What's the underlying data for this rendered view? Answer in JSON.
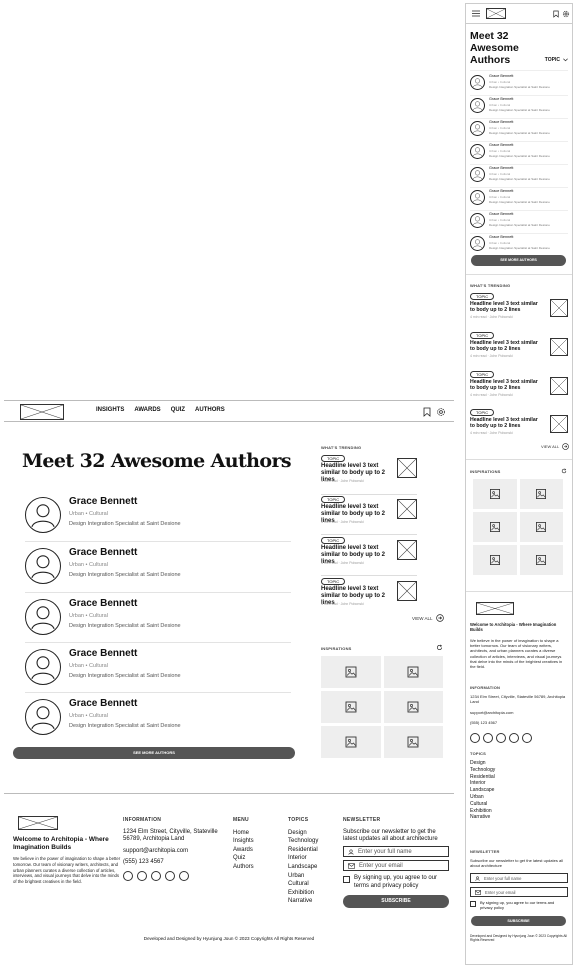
{
  "nav": {
    "menu": [
      "INSIGHTS",
      "AWARDS",
      "QUIZ",
      "AUTHORS"
    ]
  },
  "page_title": "Meet 32 Awesome Authors",
  "mobile_title": "Meet 32 Awesome Authors",
  "topic_filter": "TOPIC",
  "author": {
    "name": "Grace Bennett",
    "tags": "Urban • Cultural",
    "role": "Design Integration Specialist at Saint Desione"
  },
  "see_more_label": "SEE MORE AUTHORS",
  "trending": {
    "caption": "WHAT'S TRENDING",
    "topic": "TOPIC",
    "headline": "Headline level 3 text similar to body up to 2 lines",
    "meta": "4 min read · John Pobonski",
    "view_all": "VIEW ALL"
  },
  "inspirations": {
    "caption": "INSPIRATIONS"
  },
  "footer": {
    "welcome": "Welcome to Architopia - Where Imagination Builds",
    "description": "We believe in the power of imagination to shape a better tomorrow. Our team of visionary writers, architects, and urban planners curates a diverse collection of articles, interviews, and visual journeys that delve into the minds of the brightest creatives in the field.",
    "information_caption": "INFORMATION",
    "address": "1234 Elm Street, Cityville, Stateville 56789, Architopia Land",
    "email": "support@architopia.com",
    "phone": "(555) 123 4567",
    "menu_caption": "MENU",
    "menu_items": [
      "Home",
      "Insights",
      "Awards",
      "Quiz",
      "Authors"
    ],
    "topics_caption": "TOPICS",
    "topics": [
      "Design",
      "Technology",
      "Residential",
      "Interior",
      "Landscape",
      "Urban",
      "Cultural",
      "Exhibition",
      "Narrative"
    ],
    "newsletter_caption": "NEWSLETTER",
    "newsletter_text": "Subscribe our newsletter to get the latest updates all about architecture",
    "name_placeholder": "Enter your full name",
    "email_placeholder": "Enter your email",
    "consent": "By signing up, you agree to our terms and privacy policy",
    "subscribe": "SUBSCRIBE",
    "copyright": "Developed and Designed by Hyunjung Joun © 2023 Copyrights All Rights Reserved"
  },
  "icons": {
    "menu": "hamburger-icon",
    "bookmark": "bookmark-icon",
    "settings": "gear-icon",
    "refresh": "refresh-icon",
    "arrow": "arrow-right-circle-icon",
    "chevron": "chevron-down-icon",
    "user": "user-icon",
    "mail": "mail-icon",
    "image": "image-placeholder-icon",
    "social": "social-circle-icon"
  }
}
